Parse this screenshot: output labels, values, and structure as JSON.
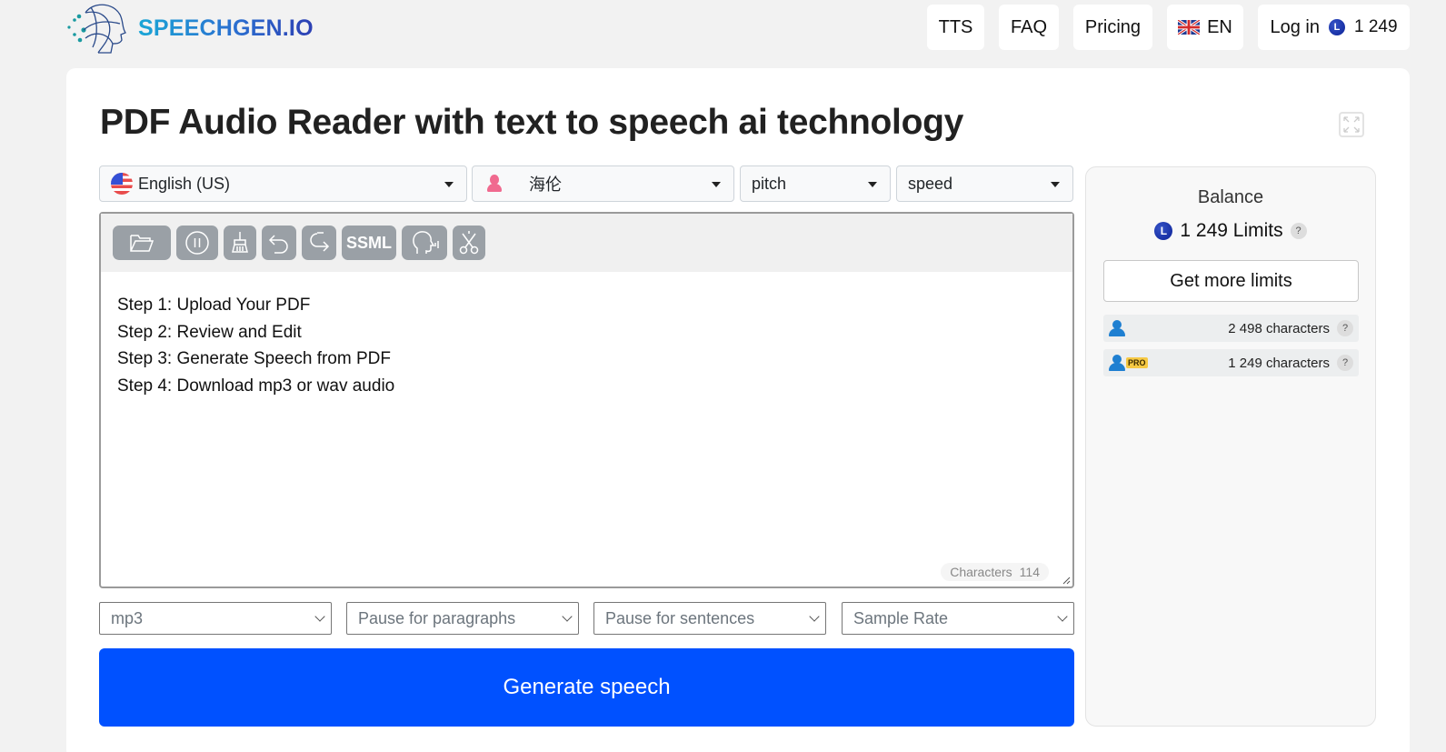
{
  "header": {
    "logo_text": "SPEECHGEN.IO",
    "nav": {
      "tts": "TTS",
      "faq": "FAQ",
      "pricing": "Pricing",
      "language": "EN",
      "login": "Log in",
      "balance": "1 249"
    }
  },
  "page": {
    "title": "PDF Audio Reader with text to speech ai technology"
  },
  "selectors": {
    "language": "English (US)",
    "voice": "海伦",
    "pitch": "pitch",
    "speed": "speed"
  },
  "toolbar": {
    "items": [
      "open-file",
      "pause",
      "clear",
      "undo",
      "redo",
      "SSML",
      "voice-preview",
      "cut"
    ],
    "ssml_label": "SSML"
  },
  "editor": {
    "lines": [
      "Step 1: Upload Your PDF",
      "Step 2: Review and Edit",
      "Step 3: Generate Speech from PDF",
      "Step 4: Download mp3 or wav audio"
    ],
    "char_label": "Characters",
    "char_count": "114"
  },
  "options": {
    "format": "mp3",
    "pause_paragraphs": "Pause for paragraphs",
    "pause_sentences": "Pause for sentences",
    "sample_rate": "Sample Rate"
  },
  "generate_label": "Generate speech",
  "balance": {
    "title": "Balance",
    "amount": "1 249 Limits",
    "help": "?",
    "get_more": "Get more limits",
    "tiers": [
      {
        "badge": "",
        "value": "2 498 characters"
      },
      {
        "badge": "PRO",
        "value": "1 249 characters"
      }
    ]
  },
  "colors": {
    "primary": "#0051ff",
    "coin": "#0b2196",
    "user_icon": "#1e7fd1",
    "pro_badge": "#f6c944"
  }
}
